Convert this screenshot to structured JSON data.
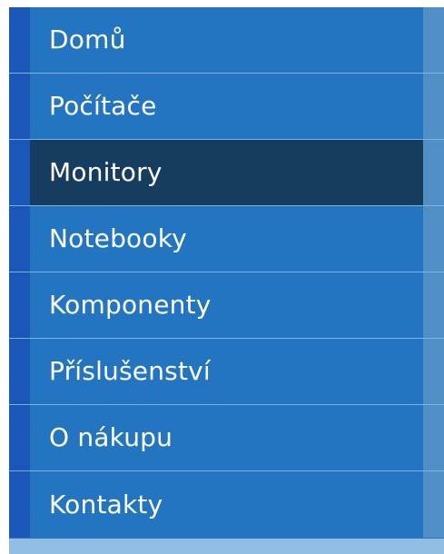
{
  "nav": {
    "items": [
      {
        "label": "Domů",
        "active": false
      },
      {
        "label": "Počítače",
        "active": false
      },
      {
        "label": "Monitory",
        "active": true
      },
      {
        "label": "Notebooky",
        "active": false
      },
      {
        "label": "Komponenty",
        "active": false
      },
      {
        "label": "Příslušenství",
        "active": false
      },
      {
        "label": "O nákupu",
        "active": false
      },
      {
        "label": "Kontakty",
        "active": false
      }
    ]
  },
  "colors": {
    "nav_background": "#2475c1",
    "nav_accent": "#1b57b8",
    "nav_active": "#163c5f",
    "nav_right_strip": "#4f8fc6",
    "divider": "#7fb3e1",
    "bottom_bar": "#91bde2",
    "text": "#ffffff"
  }
}
